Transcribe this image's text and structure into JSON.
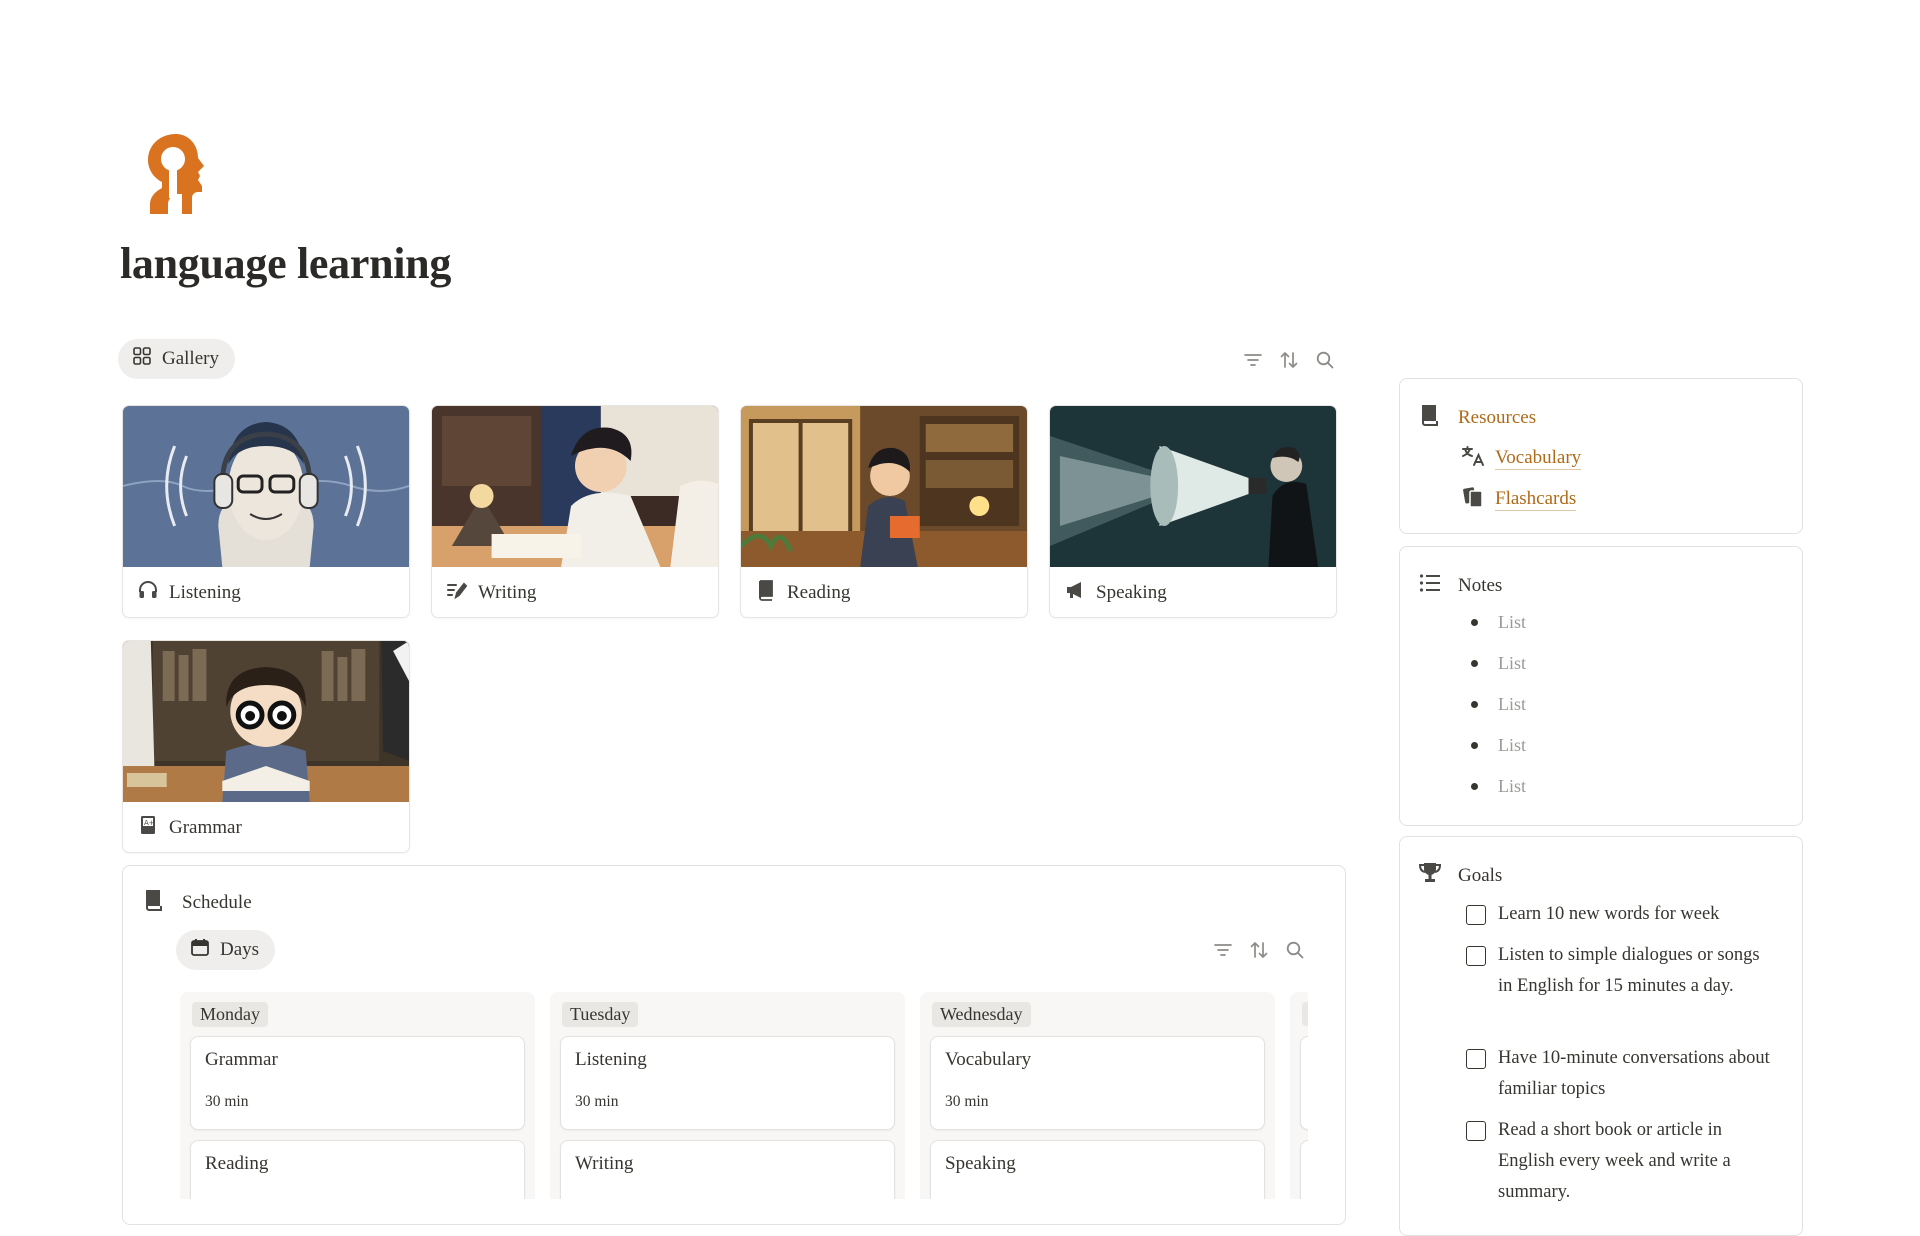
{
  "page": {
    "title": "language learning"
  },
  "gallery": {
    "view_label": "Gallery",
    "cards": [
      {
        "label": "Listening",
        "icon": "headphones-icon"
      },
      {
        "label": "Writing",
        "icon": "pen-lines-icon"
      },
      {
        "label": "Reading",
        "icon": "book-icon"
      },
      {
        "label": "Speaking",
        "icon": "megaphone-icon"
      },
      {
        "label": "Grammar",
        "icon": "grade-book-icon"
      }
    ]
  },
  "schedule": {
    "title": "Schedule",
    "view_label": "Days",
    "columns": [
      {
        "day": "Monday",
        "tasks": [
          {
            "title": "Grammar",
            "duration": "30 min"
          },
          {
            "title": "Reading",
            "duration": ""
          }
        ]
      },
      {
        "day": "Tuesday",
        "tasks": [
          {
            "title": "Listening",
            "duration": "30 min"
          },
          {
            "title": "Writing",
            "duration": ""
          }
        ]
      },
      {
        "day": "Wednesday",
        "tasks": [
          {
            "title": "Vocabulary",
            "duration": "30 min"
          },
          {
            "title": "Speaking",
            "duration": ""
          }
        ]
      }
    ]
  },
  "resources": {
    "title": "Resources",
    "links": [
      {
        "label": "Vocabulary",
        "icon": "translate-icon"
      },
      {
        "label": "Flashcards",
        "icon": "cards-icon"
      }
    ]
  },
  "notes": {
    "title": "Notes",
    "items": [
      "List",
      "List",
      "List",
      "List",
      "List"
    ]
  },
  "goals": {
    "title": "Goals",
    "items": [
      "Learn 10 new words for week",
      "Listen to simple dialogues or songs in English for 15 minutes a day.",
      "Have 10-minute conversations about familiar topics",
      "Read a short book or article in English every week and write a summary."
    ]
  },
  "colors": {
    "accent": "#b06a17",
    "brand_icon": "#d9731f",
    "text": "#37352f",
    "muted": "#9b9a97"
  }
}
